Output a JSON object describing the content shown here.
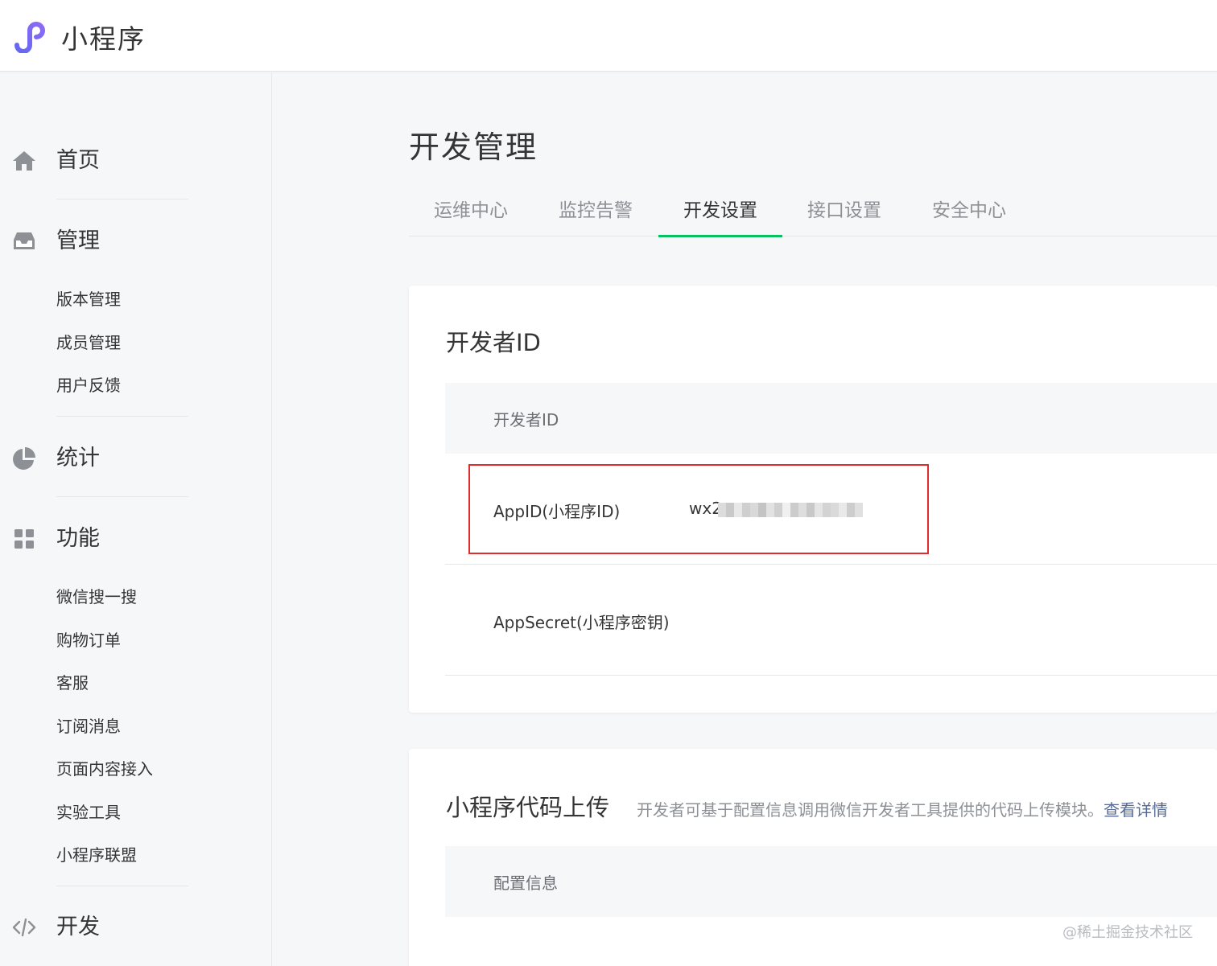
{
  "header": {
    "brand": "小程序",
    "logo_icon": "miniprogram-logo-icon"
  },
  "sidebar": {
    "sections": [
      {
        "label": "首页",
        "icon": "home-icon",
        "items": []
      },
      {
        "label": "管理",
        "icon": "inbox-icon",
        "items": [
          "版本管理",
          "成员管理",
          "用户反馈"
        ]
      },
      {
        "label": "统计",
        "icon": "pie-chart-icon",
        "items": []
      },
      {
        "label": "功能",
        "icon": "grid-icon",
        "items": [
          "微信搜一搜",
          "购物订单",
          "客服",
          "订阅消息",
          "页面内容接入",
          "实验工具",
          "小程序联盟"
        ]
      },
      {
        "label": "开发",
        "icon": "code-icon",
        "items": []
      }
    ]
  },
  "main": {
    "title": "开发管理",
    "tabs": [
      {
        "label": "运维中心",
        "active": false
      },
      {
        "label": "监控告警",
        "active": false
      },
      {
        "label": "开发设置",
        "active": true
      },
      {
        "label": "接口设置",
        "active": false
      },
      {
        "label": "安全中心",
        "active": false
      }
    ],
    "developer_card": {
      "title": "开发者ID",
      "table_header": "开发者ID",
      "appid_label": "AppID(小程序ID)",
      "appid_value": "wx2",
      "appsecret_label": "AppSecret(小程序密钥)"
    },
    "upload_card": {
      "title": "小程序代码上传",
      "description": "开发者可基于配置信息调用微信开发者工具提供的代码上传模块。",
      "link": "查看详情",
      "table_header": "配置信息"
    }
  },
  "watermark": "@稀土掘金技术社区",
  "colors": {
    "accent": "#07c160",
    "highlight": "#e22b2b",
    "link": "#576b95"
  }
}
